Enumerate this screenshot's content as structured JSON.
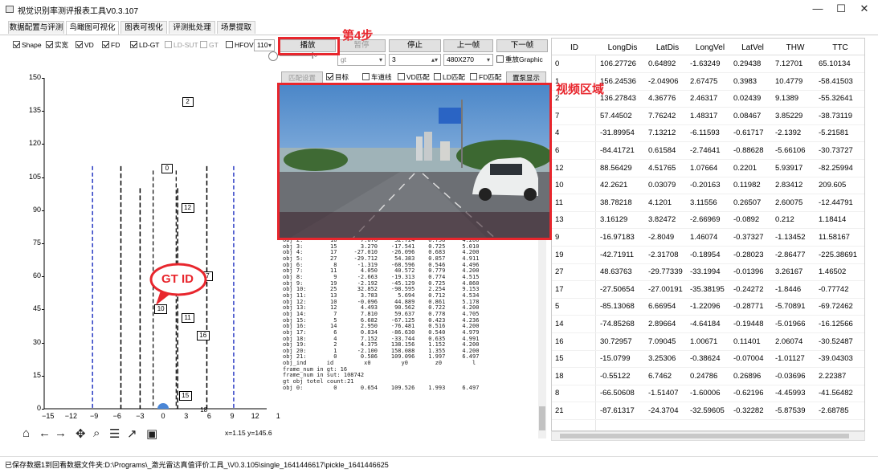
{
  "window": {
    "title": "视觉识别率测评报表工具V0.3.107",
    "min": "—",
    "max": "☐",
    "close": "✕"
  },
  "tabs": [
    "数据配置与评测",
    "鸟瞰图可视化",
    "图表可视化",
    "评测批处理",
    "场景提取"
  ],
  "checks_row1": [
    {
      "label": "Shape",
      "checked": true,
      "disabled": false
    },
    {
      "label": "实宽",
      "checked": true,
      "disabled": false
    },
    {
      "label": "VD",
      "checked": true,
      "disabled": false
    },
    {
      "label": "FD",
      "checked": true,
      "disabled": false
    },
    {
      "label": "LD-GT",
      "checked": true,
      "disabled": false
    },
    {
      "label": "LD-SUT",
      "checked": false,
      "disabled": true
    },
    {
      "label": "GT",
      "checked": false,
      "disabled": true
    },
    {
      "label": "HFOV",
      "checked": false,
      "disabled": false
    }
  ],
  "hfov_value": "110",
  "controls": {
    "play": "播放",
    "pause": "暂停",
    "stop": "停止",
    "prev": "上一帧",
    "next": "下一帧",
    "gt_select": "gt",
    "num_value": "3",
    "res_select": "480X270",
    "zoom_check": "重放Graphic",
    "match_btn": "匹配设置",
    "target": "目标",
    "lane": "车道线",
    "vd_match": "VD匹配",
    "ld_match": "LD匹配",
    "fd_match": "FD匹配",
    "reset_btn": "置泵显示"
  },
  "annotations": {
    "step4": "第4步",
    "video": "视频区域",
    "gtid": "GT ID"
  },
  "plot": {
    "y_ticks": [
      "150",
      "135",
      "120",
      "105",
      "90",
      "75",
      "60",
      "45",
      "30",
      "15",
      "0"
    ],
    "x_ticks": [
      "−15",
      "−12",
      "−9",
      "−6",
      "−3",
      "0",
      "3",
      "6",
      "9",
      "12",
      "1"
    ],
    "coord": "x=1.15 y=145.6",
    "ids": [
      {
        "id": "2",
        "x": 3.2,
        "y": 139
      },
      {
        "id": "0",
        "x": 0.5,
        "y": 109
      },
      {
        "id": "12",
        "x": 3.2,
        "y": 91
      },
      {
        "id": "7",
        "x": 5.8,
        "y": 60
      },
      {
        "id": "10",
        "x": -0.3,
        "y": 45
      },
      {
        "id": "11",
        "x": 3.2,
        "y": 41
      },
      {
        "id": "16",
        "x": 5.2,
        "y": 33
      },
      {
        "id": "15",
        "x": 2.9,
        "y": 6
      },
      {
        "id": "18",
        "x": 5.3,
        "y": -1
      }
    ]
  },
  "log": "obj 2:        16       7.076     32.724    0.758     4.200\nobj 3:        15       3.270    -17.541    0.725     5.010\nobj 4:        17     -27.010    -26.096    0.683     4.200\nobj 5:        27     -29.712     54.383    0.857     4.911\nobj 6:         8      -1.319    -68.596    0.546     4.496\nobj 7:        11       4.050     40.572    0.779     4.200\nobj 8:         9      -2.663    -19.313    0.774     4.515\nobj 9:        19      -2.192    -45.129    0.725     4.860\nobj 10:       25      32.852    -98.595    2.254     9.153\nobj 11:       13       3.783      5.694    0.712     4.534\nobj 12:       10      -0.096     44.889    0.861     5.178\nobj 13:       12       4.493     90.562    0.722     4.200\nobj 14:        7       7.810     59.637    0.778     4.705\nobj 15:        5       6.682    -67.125    0.423     4.236\nobj 16:       14       2.950    -76.481    0.516     4.200\nobj 17:        6       0.834    -86.630    0.540     4.979\nobj 18:        4       7.152    -33.744    0.635     4.991\nobj 19:        2       4.375    138.156    1.152     4.200\nobj 20:        1      -2.100    158.088    1.355     4.200\nobj 21:        0       0.586    109.096    1.997     6.497\nobj_ind      id         x0         y0        z0         l\nframe_num in gt: 16\nframe_num in sut: 108742\ngt obj totel count:21\nobj 0:         0       0.654    109.526    1.993     6.497",
  "table": {
    "headers": [
      "ID",
      "LongDis",
      "LatDis",
      "LongVel",
      "LatVel",
      "THW",
      "TTC"
    ],
    "rows": [
      [
        "0",
        "106.27726",
        "0.64892",
        "-1.63249",
        "0.29438",
        "7.12701",
        "65.10134"
      ],
      [
        "1",
        "156.24536",
        "-2.04906",
        "2.67475",
        "0.3983",
        "10.4779",
        "-58.41503"
      ],
      [
        "2",
        "136.27843",
        "4.36776",
        "2.46317",
        "0.02439",
        "9.1389",
        "-55.32641"
      ],
      [
        "7",
        "57.44502",
        "7.76242",
        "1.48317",
        "0.08467",
        "3.85229",
        "-38.73119"
      ],
      [
        "4",
        "-31.89954",
        "7.13212",
        "-6.11593",
        "-0.61717",
        "-2.1392",
        "-5.21581"
      ],
      [
        "6",
        "-84.41721",
        "0.61584",
        "-2.74641",
        "-0.88628",
        "-5.66106",
        "-30.73727"
      ],
      [
        "12",
        "88.56429",
        "4.51765",
        "1.07664",
        "0.2201",
        "5.93917",
        "-82.25994"
      ],
      [
        "10",
        "42.2621",
        "0.03079",
        "-0.20163",
        "0.11982",
        "2.83412",
        "209.605"
      ],
      [
        "11",
        "38.78218",
        "4.1201",
        "3.11556",
        "0.26507",
        "2.60075",
        "-12.44791"
      ],
      [
        "13",
        "3.16129",
        "3.82472",
        "-2.66969",
        "-0.0892",
        "0.212",
        "1.18414"
      ],
      [
        "9",
        "-16.97183",
        "-2.8049",
        "1.46074",
        "-0.37327",
        "-1.13452",
        "11.58167"
      ],
      [
        "19",
        "-42.71911",
        "-2.31708",
        "-0.18954",
        "-0.28023",
        "-2.86477",
        "-225.38691"
      ],
      [
        "27",
        "48.63763",
        "-29.77339",
        "-33.1994",
        "-0.01396",
        "3.26167",
        "1.46502"
      ],
      [
        "17",
        "-27.50654",
        "-27.00191",
        "-35.38195",
        "-0.24272",
        "-1.8446",
        "-0.77742"
      ],
      [
        "5",
        "-85.13068",
        "6.66954",
        "-1.22096",
        "-0.28771",
        "-5.70891",
        "-69.72462"
      ],
      [
        "14",
        "-74.85268",
        "2.89664",
        "-4.64184",
        "-0.19448",
        "-5.01966",
        "-16.12566"
      ],
      [
        "16",
        "30.72957",
        "7.09045",
        "1.00671",
        "0.11401",
        "2.06074",
        "-30.52487"
      ],
      [
        "15",
        "-15.0799",
        "3.25306",
        "-0.38624",
        "-0.07004",
        "-1.01127",
        "-39.04303"
      ],
      [
        "18",
        "-0.55122",
        "6.7462",
        "0.24786",
        "0.26896",
        "-0.03696",
        "2.22387"
      ],
      [
        "8",
        "-66.50608",
        "-1.51407",
        "-1.60006",
        "-0.62196",
        "-4.45993",
        "-41.56482"
      ],
      [
        "21",
        "-87.61317",
        "-24.3704",
        "-32.59605",
        "-0.32282",
        "-5.87539",
        "-2.68785"
      ]
    ]
  },
  "status": "已保存数据1到回看数据文件夹:D:\\Programs\\_激光雷达真值评价工具_\\V0.3.105\\single_1641446617\\pickle_1641446625",
  "colors": {
    "red": "#e8262d",
    "lane_blue": "#2b3cc4"
  }
}
